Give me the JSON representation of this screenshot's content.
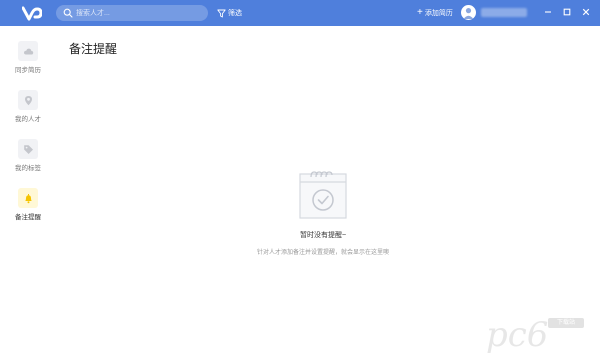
{
  "topbar": {
    "search_placeholder": "搜索人才...",
    "filter_label": "筛选",
    "add_resume_label": "添加简历",
    "accent_color": "#4f7fdc"
  },
  "sidebar": {
    "items": [
      {
        "label": "同步简历",
        "icon": "cloud-icon",
        "active": false
      },
      {
        "label": "我的人才",
        "icon": "location-pin-icon",
        "active": false
      },
      {
        "label": "我的标签",
        "icon": "tag-icon",
        "active": false
      },
      {
        "label": "备注提醒",
        "icon": "bell-icon",
        "active": true
      }
    ]
  },
  "main": {
    "title": "备注提醒",
    "empty_title": "暂时没有提醒~",
    "empty_desc": "针对人才添加备注并设置提醒，就会显示在这里噢"
  },
  "watermark": {
    "brand": "pc6",
    "sub": "下载站"
  }
}
